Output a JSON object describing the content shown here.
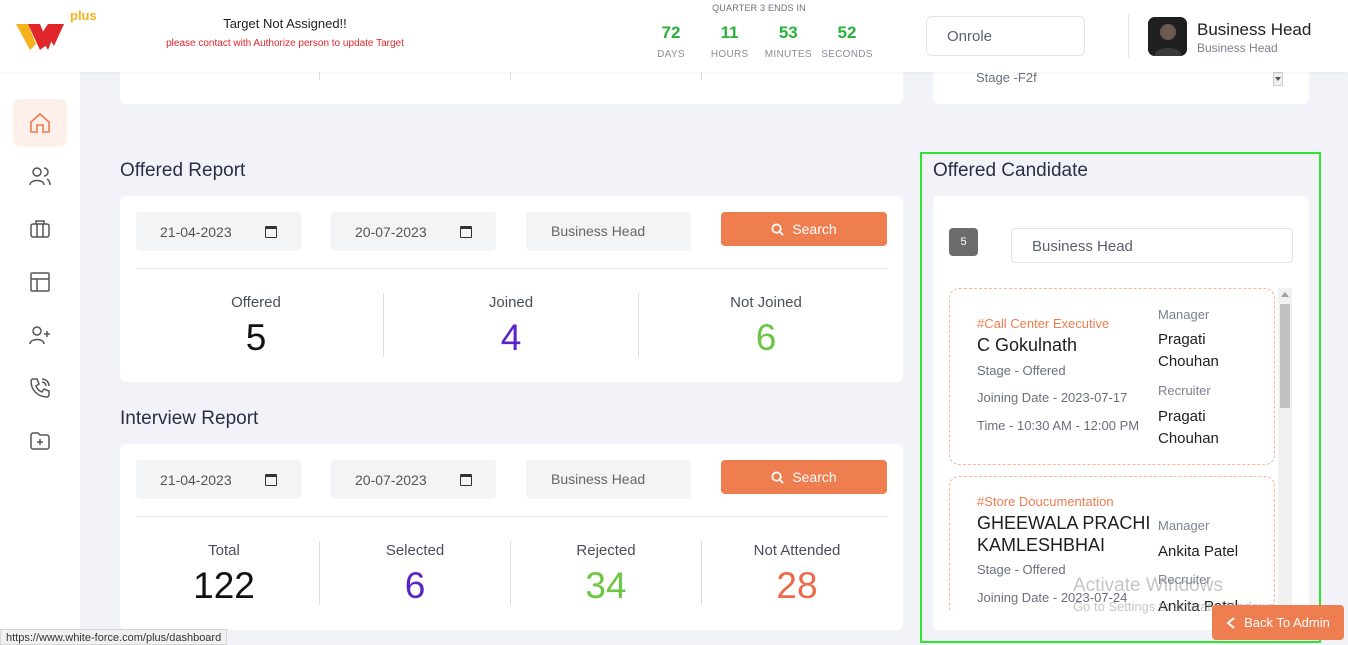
{
  "header": {
    "target_title": "Target Not Assigned!!",
    "target_sub": "please contact with Authorize person to update Target",
    "quarter_title": "QUARTER 3 ENDS IN",
    "countdown": [
      {
        "value": "72",
        "label": "DAYS"
      },
      {
        "value": "11",
        "label": "HOURS"
      },
      {
        "value": "53",
        "label": "MINUTES"
      },
      {
        "value": "52",
        "label": "SECONDS"
      }
    ],
    "role_value": "Onrole",
    "user_name": "Business Head",
    "user_role": "Business Head",
    "logo_text": "plus"
  },
  "sidebar": {
    "items": [
      "home-icon",
      "users-icon",
      "briefcase-icon",
      "layout-icon",
      "user-plus-icon",
      "phone-icon",
      "folder-plus-icon"
    ]
  },
  "top_strip": {
    "stage_text": "Stage -F2f"
  },
  "offered_report": {
    "title": "Offered Report",
    "from_date": "21-04-2023",
    "to_date": "20-07-2023",
    "filter": "Business Head",
    "search_label": "Search",
    "stats": [
      {
        "label": "Offered",
        "value": "5",
        "color": "#111111"
      },
      {
        "label": "Joined",
        "value": "4",
        "color": "#5a22c8"
      },
      {
        "label": "Not Joined",
        "value": "6",
        "color": "#6cc644"
      }
    ]
  },
  "interview_report": {
    "title": "Interview Report",
    "from_date": "21-04-2023",
    "to_date": "20-07-2023",
    "filter": "Business Head",
    "search_label": "Search",
    "stats": [
      {
        "label": "Total",
        "value": "122",
        "color": "#111111"
      },
      {
        "label": "Selected",
        "value": "6",
        "color": "#5a22c8"
      },
      {
        "label": "Rejected",
        "value": "34",
        "color": "#6cc644"
      },
      {
        "label": "Not Attended",
        "value": "28",
        "color": "#ec6a4a"
      }
    ]
  },
  "offered_candidate": {
    "title": "Offered Candidate",
    "count": "5",
    "filter": "Business Head",
    "candidates": [
      {
        "tag": "#Call Center Executive",
        "name": "C Gokulnath",
        "stage": "Stage - Offered",
        "joining": "Joining Date - 2023-07-17",
        "time": "Time - 10:30 AM - 12:00 PM",
        "manager_label": "Manager",
        "manager": "Pragati Chouhan",
        "recruiter_label": "Recruiter",
        "recruiter": "Pragati Chouhan"
      },
      {
        "tag": "#Store Doucumentation",
        "name": "GHEEWALA PRACHI KAMLESHBHAI",
        "stage": "Stage - Offered",
        "joining": "Joining Date - 2023-07-24",
        "manager_label": "Manager",
        "manager": "Ankita Patel",
        "recruiter_label": "Recruiter",
        "recruiter": "Ankita Patel"
      }
    ]
  },
  "watermark": {
    "line1": "Activate Windows",
    "line2": "Go to Settings to activate Windows."
  },
  "back_button": "Back To Admin",
  "status_url": "https://www.white-force.com/plus/dashboard"
}
